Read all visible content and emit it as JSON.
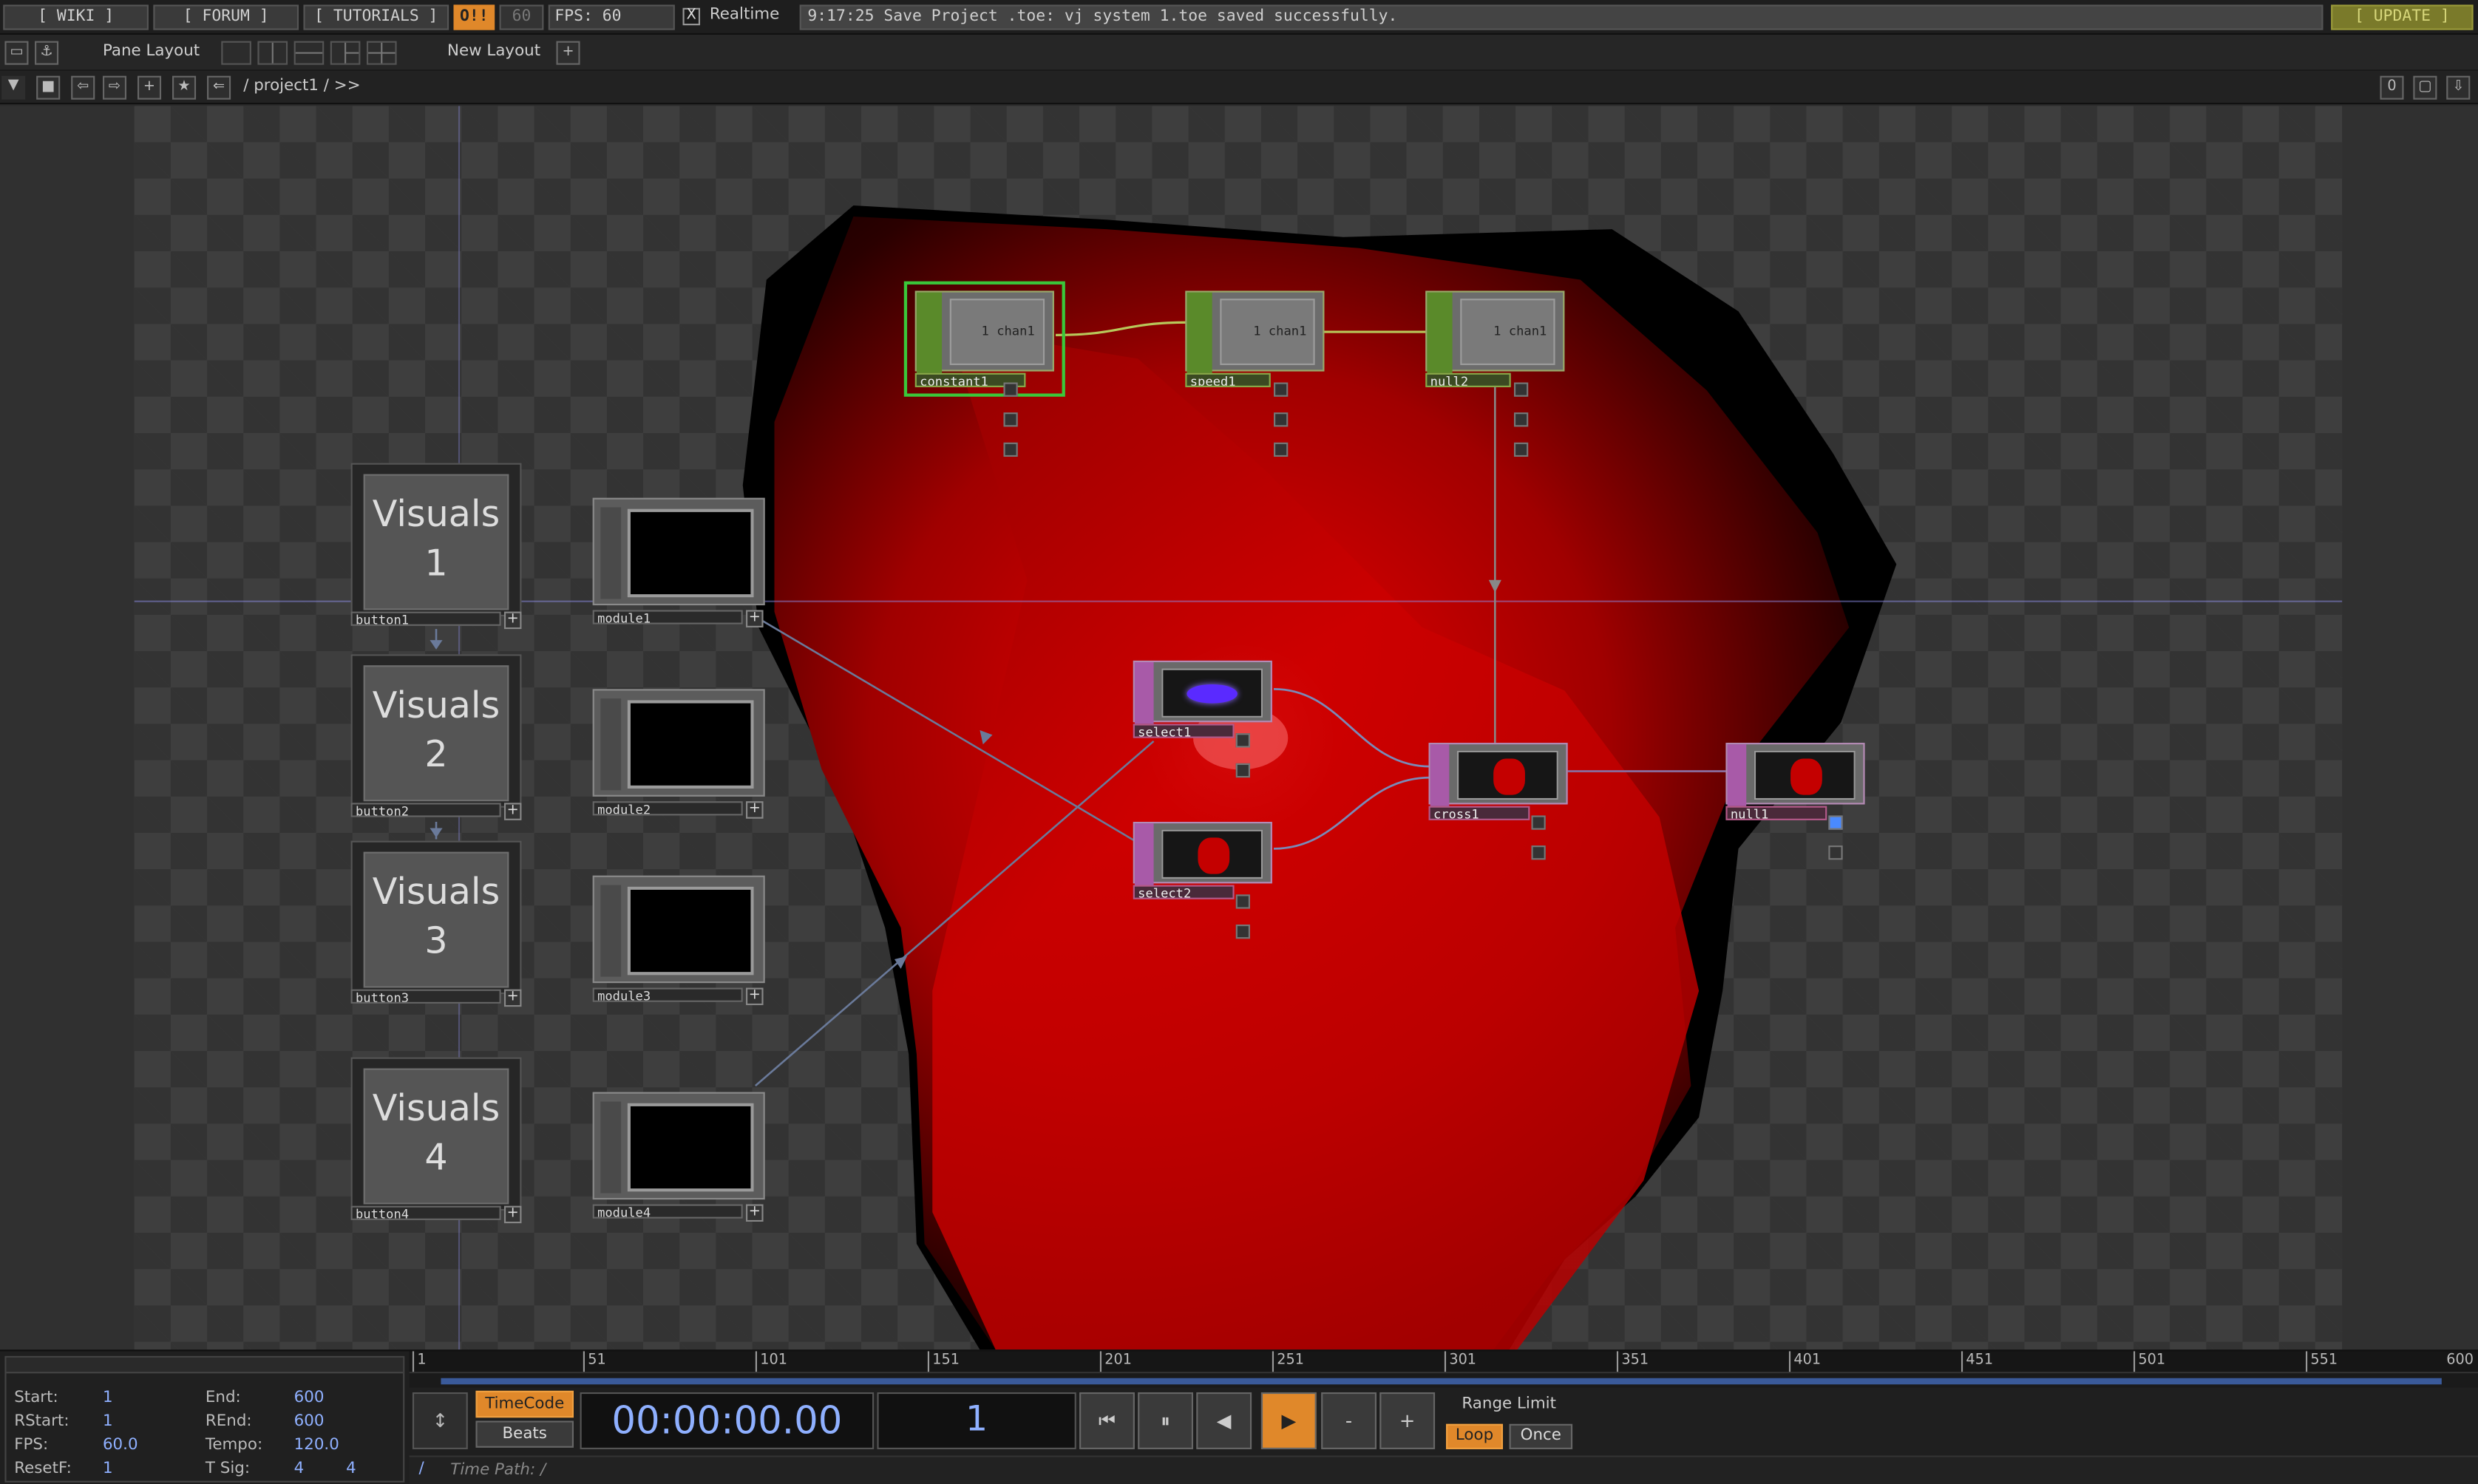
{
  "topbar": {
    "wiki": "[ WIKI ]",
    "forum": "[ FORUM ]",
    "tutorials": "[ TUTORIALS ]",
    "ok_badge": "O!!",
    "fps_dim": "60",
    "fps_label": "FPS:  60",
    "realtime_label": "Realtime",
    "realtime_checked": "X",
    "status": "9:17:25 Save Project .toe: vj system 1.toe saved successfully.",
    "update": "[ UPDATE ]"
  },
  "panebar": {
    "pane_layout": "Pane Layout",
    "new_layout": "New Layout",
    "plus": "+"
  },
  "pathbar": {
    "path": "/ project1 / >>",
    "right_count": "0"
  },
  "network": {
    "buttons": [
      {
        "line1": "Visuals",
        "line2": "1",
        "name": "button1"
      },
      {
        "line1": "Visuals",
        "line2": "2",
        "name": "button2"
      },
      {
        "line1": "Visuals",
        "line2": "3",
        "name": "button3"
      },
      {
        "line1": "Visuals",
        "line2": "4",
        "name": "button4"
      }
    ],
    "modules": [
      "module1",
      "module2",
      "module3",
      "module4"
    ],
    "chops": [
      {
        "name": "constant1",
        "value": "1",
        "chan": "chan1"
      },
      {
        "name": "speed1",
        "value": "1",
        "chan": "chan1"
      },
      {
        "name": "null2",
        "value": "1",
        "chan": "chan1"
      }
    ],
    "tops": [
      "select1",
      "select2",
      "cross1",
      "null1"
    ],
    "colors": {
      "chop": "#5a8a2a",
      "top": "#a85aa8",
      "selected": "#3ac83a",
      "background_red": "#c40000"
    }
  },
  "timeline": {
    "ruler": [
      "1",
      "51",
      "101",
      "151",
      "201",
      "251",
      "301",
      "351",
      "401",
      "451",
      "501",
      "551",
      "600"
    ],
    "info": {
      "start_k": "Start:",
      "start_v": "1",
      "end_k": "End:",
      "end_v": "600",
      "rstart_k": "RStart:",
      "rstart_v": "1",
      "rend_k": "REnd:",
      "rend_v": "600",
      "fps_k": "FPS:",
      "fps_v": "60.0",
      "tempo_k": "Tempo:",
      "tempo_v": "120.0",
      "resetf_k": "ResetF:",
      "resetf_v": "1",
      "tsig_k": "T Sig:",
      "tsig_v1": "4",
      "tsig_v2": "4"
    },
    "timecode_label": "TimeCode",
    "beats_label": "Beats",
    "timecode": "00:00:00.00",
    "frame": "1",
    "range_limit": "Range Limit",
    "loop": "Loop",
    "once": "Once",
    "minus": "-",
    "plus": "+",
    "time_path": "Time Path: /",
    "root_slash": "/"
  }
}
